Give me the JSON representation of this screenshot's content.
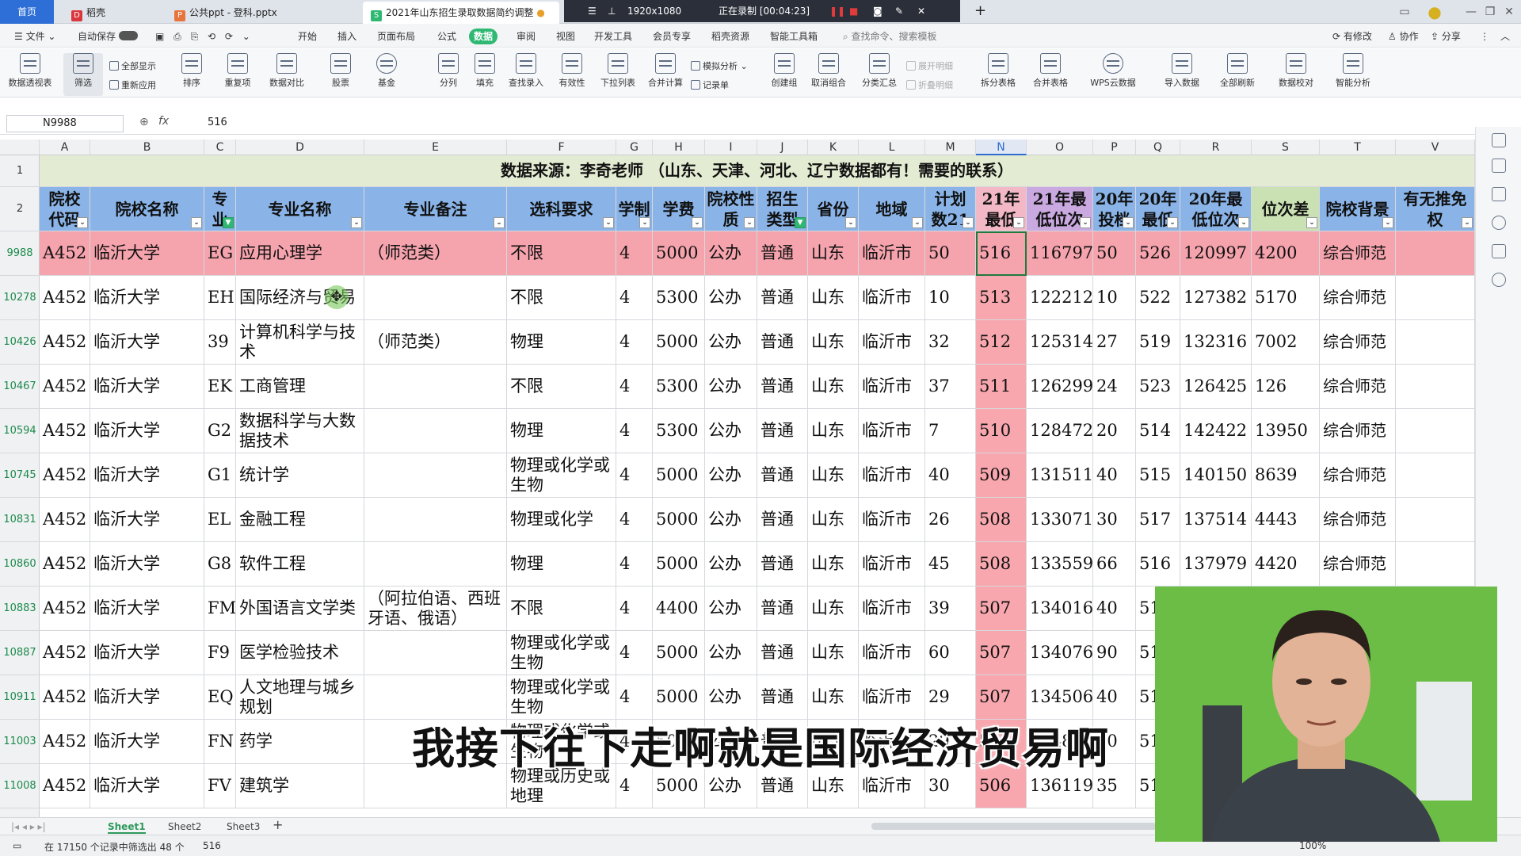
{
  "tabs": {
    "home": "首页",
    "tab1": "稻壳",
    "tab2": "公共ppt - 登科.pptx",
    "tab3": "2021年山东招生录取数据简约调整",
    "add": "+"
  },
  "recorder": {
    "resolution": "1920x1080",
    "status": "正在录制 [00:04:23]"
  },
  "menus": [
    "文件",
    "自动保存",
    "开始",
    "插入",
    "页面布局",
    "公式",
    "数据",
    "审阅",
    "视图",
    "开发工具",
    "会员专享",
    "稻壳资源",
    "智能工具箱"
  ],
  "menu_search": "查找命令、搜索模板",
  "menu_right": [
    "有修改",
    "协作",
    "分享"
  ],
  "ribbon": {
    "big": [
      "数据透视表",
      "筛选",
      "排序",
      "重复项",
      "数据对比",
      "股票",
      "基金",
      "分列",
      "填充",
      "查找录入",
      "有效性",
      "下拉列表",
      "合并计算",
      "创建组",
      "取消组合",
      "分类汇总",
      "拆分表格",
      "合并表格",
      "WPS云数据",
      "导入数据",
      "全部刷新",
      "数据校对",
      "智能分析"
    ],
    "small": [
      "全部显示",
      "重新应用",
      "模拟分析",
      "记录单",
      "展开明细",
      "折叠明细"
    ]
  },
  "formula_bar": {
    "name_box": "N9988",
    "fx": "fx",
    "value": "516"
  },
  "columns": [
    "A",
    "B",
    "C",
    "D",
    "E",
    "F",
    "G",
    "H",
    "I",
    "J",
    "K",
    "L",
    "M",
    "N",
    "O",
    "P",
    "Q",
    "R",
    "S",
    "T",
    "V"
  ],
  "row1_title": "数据来源：李奇老师 （山东、天津、河北、辽宁数据都有！需要的联系）",
  "headers": [
    "院校代码",
    "院校名称",
    "专业",
    "专业名称",
    "专业备注",
    "选科要求",
    "学制",
    "学费",
    "院校性质",
    "招生类型",
    "省份",
    "地域",
    "计划数21",
    "21年最低",
    "21年最低位次",
    "20年投档",
    "20年最低",
    "20年最低位次",
    "位次差",
    "院校背景",
    "有无推免权"
  ],
  "row_numbers": [
    "1",
    "2",
    "9988",
    "10278",
    "10426",
    "10467",
    "10594",
    "10745",
    "10831",
    "10860",
    "10883",
    "10887",
    "10911",
    "11003",
    "11008"
  ],
  "rows": [
    [
      "A452",
      "临沂大学",
      "EG",
      "应用心理学",
      "（师范类）",
      "不限",
      "4",
      "5000",
      "公办",
      "普通",
      "山东",
      "临沂市",
      "50",
      "516",
      "116797",
      "50",
      "526",
      "120997",
      "4200",
      "综合师范",
      ""
    ],
    [
      "A452",
      "临沂大学",
      "EH",
      "国际经济与贸易",
      "",
      "不限",
      "4",
      "5300",
      "公办",
      "普通",
      "山东",
      "临沂市",
      "10",
      "513",
      "122212",
      "10",
      "522",
      "127382",
      "5170",
      "综合师范",
      ""
    ],
    [
      "A452",
      "临沂大学",
      "39",
      "计算机科学与技术",
      "（师范类）",
      "物理",
      "4",
      "5000",
      "公办",
      "普通",
      "山东",
      "临沂市",
      "32",
      "512",
      "125314",
      "27",
      "519",
      "132316",
      "7002",
      "综合师范",
      ""
    ],
    [
      "A452",
      "临沂大学",
      "EK",
      "工商管理",
      "",
      "不限",
      "4",
      "5300",
      "公办",
      "普通",
      "山东",
      "临沂市",
      "37",
      "511",
      "126299",
      "24",
      "523",
      "126425",
      "126",
      "综合师范",
      ""
    ],
    [
      "A452",
      "临沂大学",
      "G2",
      "数据科学与大数据技术",
      "",
      "物理",
      "4",
      "5300",
      "公办",
      "普通",
      "山东",
      "临沂市",
      "7",
      "510",
      "128472",
      "20",
      "514",
      "142422",
      "13950",
      "综合师范",
      ""
    ],
    [
      "A452",
      "临沂大学",
      "G1",
      "统计学",
      "",
      "物理或化学或生物",
      "4",
      "5000",
      "公办",
      "普通",
      "山东",
      "临沂市",
      "40",
      "509",
      "131511",
      "40",
      "515",
      "140150",
      "8639",
      "综合师范",
      ""
    ],
    [
      "A452",
      "临沂大学",
      "EL",
      "金融工程",
      "",
      "物理或化学",
      "4",
      "5000",
      "公办",
      "普通",
      "山东",
      "临沂市",
      "26",
      "508",
      "133071",
      "30",
      "517",
      "137514",
      "4443",
      "综合师范",
      ""
    ],
    [
      "A452",
      "临沂大学",
      "G8",
      "软件工程",
      "",
      "物理",
      "4",
      "5000",
      "公办",
      "普通",
      "山东",
      "临沂市",
      "45",
      "508",
      "133559",
      "66",
      "516",
      "137979",
      "4420",
      "综合师范",
      ""
    ],
    [
      "A452",
      "临沂大学",
      "FM",
      "外国语言文学类",
      "（阿拉伯语、西班牙语、俄语）",
      "不限",
      "4",
      "4400",
      "公办",
      "普通",
      "山东",
      "临沂市",
      "39",
      "507",
      "134016",
      "40",
      "51",
      "",
      "",
      "",
      ""
    ],
    [
      "A452",
      "临沂大学",
      "F9",
      "医学检验技术",
      "",
      "物理或化学或生物",
      "4",
      "5000",
      "公办",
      "普通",
      "山东",
      "临沂市",
      "60",
      "507",
      "134076",
      "90",
      "51",
      "",
      "",
      "",
      ""
    ],
    [
      "A452",
      "临沂大学",
      "EQ",
      "人文地理与城乡规划",
      "",
      "物理或化学或生物",
      "4",
      "5000",
      "公办",
      "普通",
      "山东",
      "临沂市",
      "29",
      "507",
      "134506",
      "40",
      "51",
      "",
      "",
      "",
      ""
    ],
    [
      "A452",
      "临沂大学",
      "FN",
      "药学",
      "",
      "物理或化学或生物",
      "4",
      "5000",
      "公办",
      "普通",
      "山东",
      "临沂市",
      "29",
      "507",
      "134816",
      "40",
      "51",
      "",
      "",
      "",
      ""
    ],
    [
      "A452",
      "临沂大学",
      "FV",
      "建筑学",
      "",
      "物理或历史或地理",
      "4",
      "5000",
      "公办",
      "普通",
      "山东",
      "临沂市",
      "30",
      "506",
      "136119",
      "35",
      "51",
      "",
      "",
      "",
      ""
    ]
  ],
  "sheets": [
    "Sheet1",
    "Sheet2",
    "Sheet3"
  ],
  "status": {
    "filter_info": "在 17150 个记录中筛选出 48 个",
    "value": "516",
    "zoom": "100%"
  },
  "subtitle": "我接下往下走啊就是国际经济贸易啊",
  "colors": {
    "header_blue": "#8ab4e8",
    "selected_row": "#f5a3ad",
    "n_column": "#f8a7ae",
    "title_row": "#e3ecd3",
    "active_tab": "#2eb872"
  }
}
